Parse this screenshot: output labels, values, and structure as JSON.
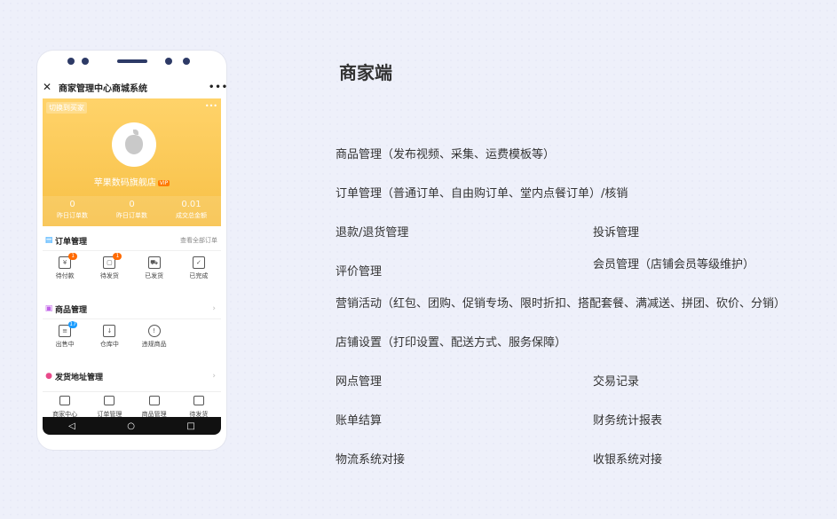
{
  "phone": {
    "title": "商家管理中心商城系统",
    "close_glyph": "✕",
    "more_glyph": "•••",
    "switch_label": "切换到买家",
    "shop_name": "苹果数码旗舰店",
    "shop_badge": "VIP",
    "stats": [
      {
        "value": "0",
        "label": "昨日订单数"
      },
      {
        "value": "0",
        "label": "昨日订单数"
      },
      {
        "value": "0.01",
        "label": "成交总金额"
      }
    ],
    "orders": {
      "title": "订单管理",
      "view_all": "查看全部订单",
      "items": [
        {
          "label": "待付款",
          "badge": "1",
          "icon": "wallet-icon"
        },
        {
          "label": "待发货",
          "badge": "1",
          "icon": "box-icon"
        },
        {
          "label": "已发货",
          "badge": "",
          "icon": "truck-icon"
        },
        {
          "label": "已完成",
          "badge": "",
          "icon": "clipboard-icon"
        }
      ]
    },
    "goods": {
      "title": "商品管理",
      "items": [
        {
          "label": "出售中",
          "badge": "17",
          "icon": "sale-icon"
        },
        {
          "label": "仓库中",
          "badge": "",
          "icon": "warehouse-icon"
        },
        {
          "label": "违规商品",
          "badge": "",
          "icon": "warning-icon"
        }
      ]
    },
    "address": {
      "title": "发货地址管理"
    },
    "tabs": [
      {
        "label": "商家中心",
        "icon": "home-icon"
      },
      {
        "label": "订单管理",
        "icon": "order-icon"
      },
      {
        "label": "商品管理",
        "icon": "goods-icon"
      },
      {
        "label": "待发货",
        "icon": "truck-icon"
      }
    ],
    "nav": {
      "back": "◁",
      "home": "○",
      "recent": "□"
    }
  },
  "heading": "商家端",
  "features": {
    "goods": "商品管理（发布视频、采集、运费模板等）",
    "orders": "订单管理（普通订单、自由购订单、堂内点餐订单）/核销",
    "refund": "退款/退货管理",
    "complaint": "投诉管理",
    "review": "评价管理",
    "member": "会员管理（店铺会员等级维护）",
    "marketing": "营销活动（红包、团购、促销专场、限时折扣、搭配套餐、满减送、拼团、砍价、分销）",
    "store": "店铺设置（打印设置、配送方式、服务保障）",
    "outlet": "网点管理",
    "trade": "交易记录",
    "bill": "账单结算",
    "finance": "财务统计报表",
    "logistics": "物流系统对接",
    "cashier": "收银系统对接"
  }
}
